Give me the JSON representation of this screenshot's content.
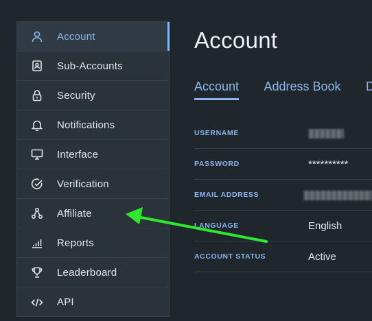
{
  "sidebar": {
    "items": [
      {
        "label": "Account",
        "icon": "user-icon",
        "active": true
      },
      {
        "label": "Sub-Accounts",
        "icon": "contact-book-icon",
        "active": false
      },
      {
        "label": "Security",
        "icon": "lock-icon",
        "active": false
      },
      {
        "label": "Notifications",
        "icon": "bell-icon",
        "active": false
      },
      {
        "label": "Interface",
        "icon": "monitor-icon",
        "active": false
      },
      {
        "label": "Verification",
        "icon": "check-circle-icon",
        "active": false
      },
      {
        "label": "Affiliate",
        "icon": "share-nodes-icon",
        "active": false
      },
      {
        "label": "Reports",
        "icon": "bar-chart-icon",
        "active": false
      },
      {
        "label": "Leaderboard",
        "icon": "trophy-icon",
        "active": false
      },
      {
        "label": "API",
        "icon": "code-icon",
        "active": false
      }
    ]
  },
  "main": {
    "title": "Account",
    "tabs": [
      {
        "label": "Account",
        "active": true
      },
      {
        "label": "Address Book",
        "active": false
      },
      {
        "label": "D",
        "active": false
      }
    ],
    "fields": [
      {
        "key": "USERNAME",
        "value": "",
        "redacted": true
      },
      {
        "key": "PASSWORD",
        "value": "**********",
        "redacted": false
      },
      {
        "key": "EMAIL ADDRESS",
        "value": "",
        "redacted": true
      },
      {
        "key": "LANGUAGE",
        "value": "English",
        "redacted": false
      },
      {
        "key": "ACCOUNT STATUS",
        "value": "Active",
        "redacted": false
      }
    ]
  },
  "colors": {
    "background": "#1f262c",
    "sidebar": "#2a323a",
    "accent": "#8ab6ee",
    "annotation_arrow": "#2ee82e"
  }
}
